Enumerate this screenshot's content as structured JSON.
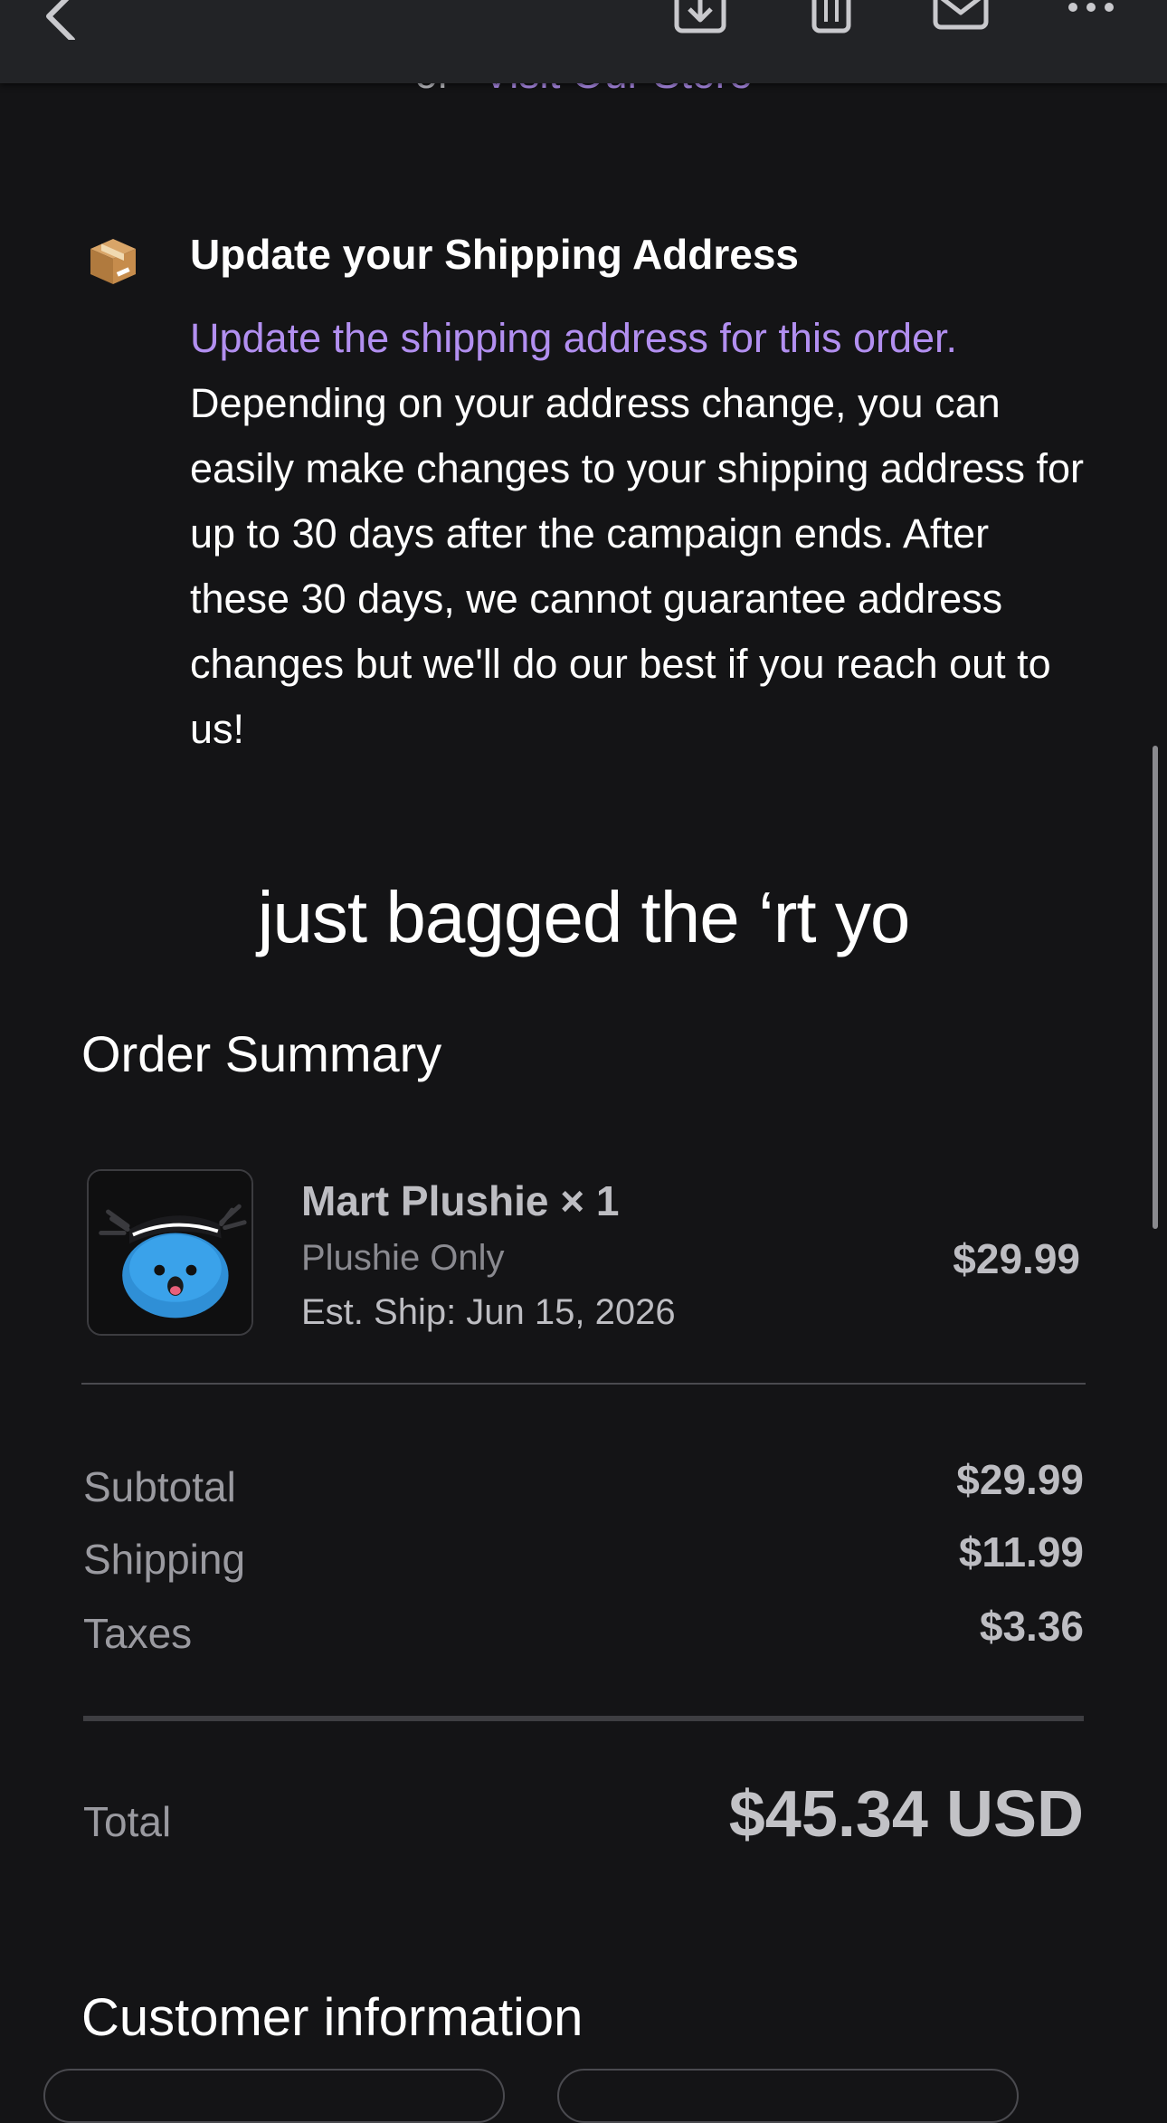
{
  "header": {
    "icons": [
      "back-chevron-icon",
      "archive-download-icon",
      "trash-icon",
      "mail-icon",
      "more-icon"
    ]
  },
  "visit": {
    "prefix": "or",
    "link_label": "Visit Our Store"
  },
  "shipping_update": {
    "icon": "package-icon",
    "title": "Update your Shipping Address",
    "link_text": "Update the shipping address for this order.",
    "body": " Depending on your address change, you can easily make changes to your shipping address for up to 30 days after the campaign ends. After these 30 days, we cannot guarantee address changes but we'll do our best if you reach out to us!"
  },
  "tagline": "just bagged the ‘rt yo",
  "order_summary": {
    "heading": "Order Summary",
    "item": {
      "name": "Mart Plushie × 1",
      "variant": "Plushie Only",
      "est_ship": "Est. Ship: Jun 15, 2026",
      "price": "$29.99"
    },
    "subtotal_label": "Subtotal",
    "subtotal_value": "$29.99",
    "shipping_label": "Shipping",
    "shipping_value": "$11.99",
    "taxes_label": "Taxes",
    "taxes_value": "$3.36",
    "total_label": "Total",
    "total_value": "$45.34 USD"
  },
  "customer_info": {
    "heading": "Customer information"
  },
  "colors": {
    "background": "#141416",
    "link": "#b28ff0",
    "toolbar": "#222326"
  }
}
